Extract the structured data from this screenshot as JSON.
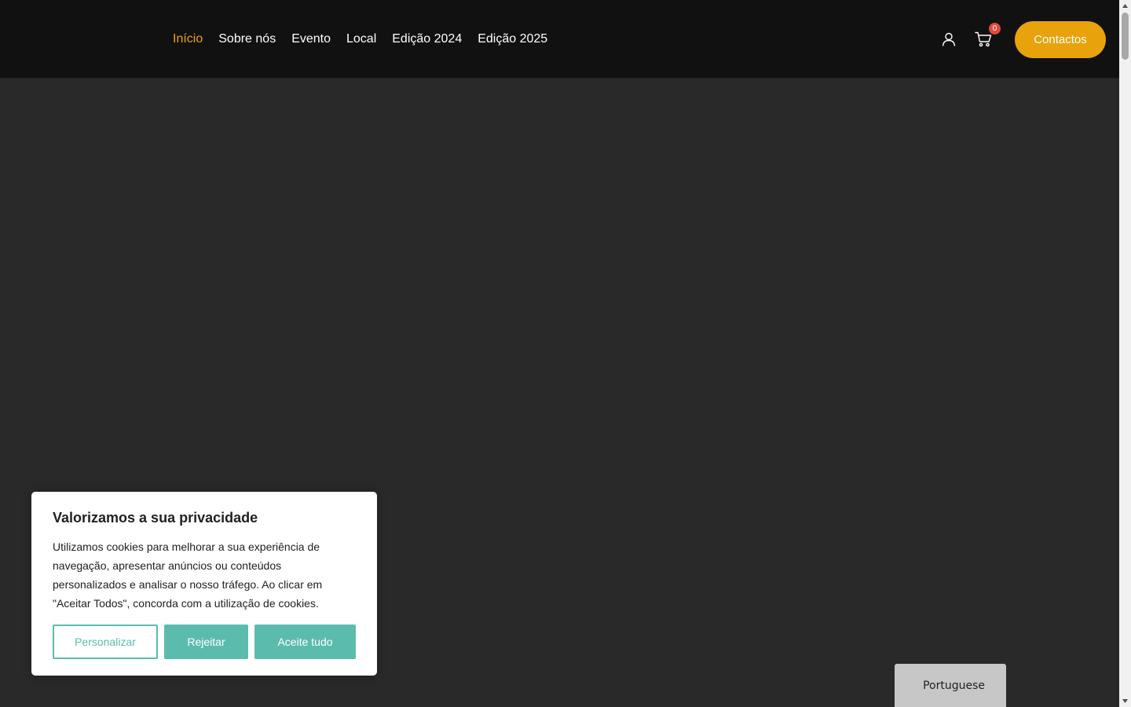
{
  "nav": {
    "items": [
      {
        "label": "Início",
        "active": true
      },
      {
        "label": "Sobre nós",
        "active": false
      },
      {
        "label": "Evento",
        "active": false
      },
      {
        "label": "Local",
        "active": false
      },
      {
        "label": "Edição 2024",
        "active": false
      },
      {
        "label": "Edição 2025",
        "active": false
      }
    ]
  },
  "header": {
    "user_icon": "user-icon",
    "cart_icon": "cart-icon",
    "cart_count": "0",
    "contact_label": "Contactos"
  },
  "cookie": {
    "title": "Valorizamos a sua privacidade",
    "text": "Utilizamos cookies para melhorar a sua experiência de navegação, apresentar anúncios ou conteúdos personalizados e analisar o nosso tráfego. Ao clicar em \"Aceitar Todos\", concorda com a utilização de cookies.",
    "customize_label": "Personalizar",
    "reject_label": "Rejeitar",
    "accept_label": "Aceite tudo"
  },
  "language": {
    "current": "Portuguese"
  },
  "colors": {
    "accent": "#e8a30c",
    "header_bg": "#111111",
    "page_bg": "#292929",
    "cookie_button": "#5bbcad",
    "badge": "#e14b3b"
  }
}
